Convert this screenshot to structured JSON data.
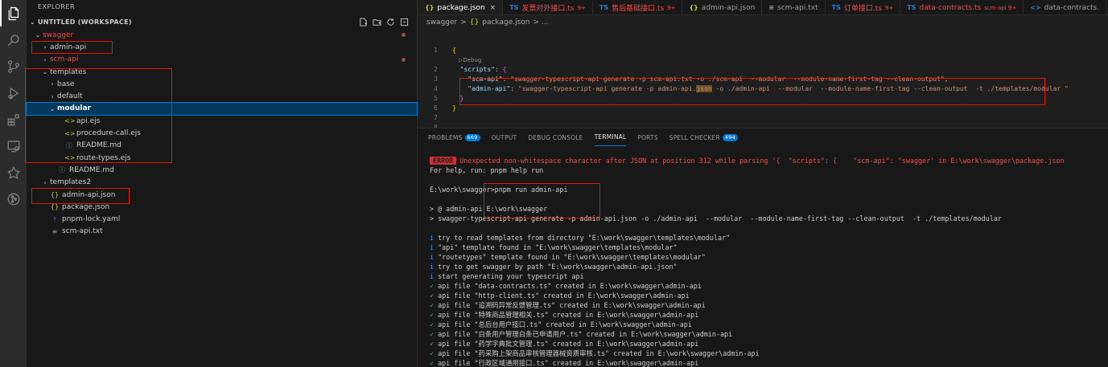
{
  "activity_bar": {
    "icons": [
      "files-icon",
      "search-icon",
      "source-control-icon",
      "run-debug-icon",
      "extensions-icon",
      "remote-explorer-icon",
      "gitlens-icon",
      "git-graph-icon"
    ]
  },
  "explorer": {
    "title": "EXPLORER",
    "workspace": "UNTITLED (WORKSPACE)",
    "tree": [
      {
        "label": "swagger",
        "depth": 0,
        "kind": "folder-open",
        "red": true,
        "dot": true
      },
      {
        "label": "admin-api",
        "depth": 1,
        "kind": "folder",
        "red": false,
        "dot": false
      },
      {
        "label": "scm-api",
        "depth": 1,
        "kind": "folder",
        "red": true,
        "dot": true
      },
      {
        "label": "templates",
        "depth": 1,
        "kind": "folder-open",
        "red": false,
        "dot": false
      },
      {
        "label": "base",
        "depth": 2,
        "kind": "folder",
        "red": false,
        "dot": false
      },
      {
        "label": "default",
        "depth": 2,
        "kind": "folder",
        "red": false,
        "dot": false
      },
      {
        "label": "modular",
        "depth": 2,
        "kind": "folder-open",
        "red": false,
        "dot": false,
        "selected": true
      },
      {
        "label": "api.ejs",
        "depth": 3,
        "kind": "ejs",
        "red": false,
        "dot": false
      },
      {
        "label": "procedure-call.ejs",
        "depth": 3,
        "kind": "ejs",
        "red": false,
        "dot": false
      },
      {
        "label": "README.md",
        "depth": 3,
        "kind": "info",
        "red": false,
        "dot": false
      },
      {
        "label": "route-types.ejs",
        "depth": 3,
        "kind": "ejs",
        "red": false,
        "dot": false
      },
      {
        "label": "README.md",
        "depth": 2,
        "kind": "info",
        "red": false,
        "dot": false
      },
      {
        "label": "templates2",
        "depth": 1,
        "kind": "folder",
        "red": false,
        "dot": false
      },
      {
        "label": "admin-api.json",
        "depth": 1,
        "kind": "json",
        "red": false,
        "dot": false
      },
      {
        "label": "package.json",
        "depth": 1,
        "kind": "json",
        "red": false,
        "dot": false
      },
      {
        "label": "pnpm-lock.yaml",
        "depth": 1,
        "kind": "yaml",
        "red": false,
        "dot": false
      },
      {
        "label": "scm-api.txt",
        "depth": 1,
        "kind": "txt",
        "red": false,
        "dot": false
      }
    ]
  },
  "tabs": [
    {
      "icon": "{}",
      "type": "json",
      "name": "package.json",
      "active": true,
      "err": false,
      "badge": "",
      "close": "×"
    },
    {
      "icon": "TS",
      "type": "ts",
      "name": "发票对外接口.ts",
      "active": false,
      "err": true,
      "badge": "9+",
      "close": ""
    },
    {
      "icon": "TS",
      "type": "ts",
      "name": "售后基础接口.ts",
      "active": false,
      "err": true,
      "badge": "9+",
      "close": ""
    },
    {
      "icon": "{}",
      "type": "json",
      "name": "admin-api.json",
      "active": false,
      "err": false,
      "badge": "",
      "close": ""
    },
    {
      "icon": "≡",
      "type": "txt",
      "name": "scm-api.txt",
      "active": false,
      "err": false,
      "badge": "",
      "close": ""
    },
    {
      "icon": "TS",
      "type": "ts",
      "name": "订单接口.ts",
      "active": false,
      "err": true,
      "badge": "9+",
      "close": ""
    },
    {
      "icon": "TS",
      "type": "ts",
      "name": "data-contracts.ts",
      "active": false,
      "err": true,
      "badge": "scm-api 9+",
      "close": ""
    },
    {
      "icon": "<>",
      "type": "ts",
      "name": "data-contracts.",
      "active": false,
      "err": false,
      "badge": "",
      "close": ""
    }
  ],
  "breadcrumb": {
    "folder": "swagger",
    "sep": ">",
    "file_icon": "{}",
    "file": "package.json",
    "tail": "> ..."
  },
  "code": {
    "debug_label": "▷Debug",
    "lines": [
      {
        "n": "1",
        "parts": [
          [
            "{",
            "c-brace"
          ]
        ]
      },
      {
        "n": "",
        "debug": true
      },
      {
        "n": "2",
        "parts": [
          [
            "  \"scripts\"",
            "c-key"
          ],
          [
            ": ",
            "c-punct"
          ],
          [
            "{",
            "c-brace2"
          ]
        ]
      },
      {
        "n": "3",
        "parts": [
          [
            "    \"scm-api\"",
            "c-key"
          ],
          [
            ": ",
            "c-punct"
          ],
          [
            "\"swagger-typescript-api generate -p scm-api.txt -o ./scm-api  --modular  --module-name-first-tag --clean-output\"",
            "c-str"
          ],
          [
            ",",
            "c-punct"
          ]
        ]
      },
      {
        "n": "4",
        "parts": [
          [
            "    \"admin-api\"",
            "c-key"
          ],
          [
            ": ",
            "c-punct"
          ],
          [
            "\"swagger-typescript-api generate -p admin-api.",
            "c-str"
          ],
          [
            "json",
            "c-str jsonhl"
          ],
          [
            " -o ./admin-api  --modular  --module-name-first-tag --clean-output  -t ./templates/modular \"",
            "c-str"
          ]
        ]
      },
      {
        "n": "5",
        "parts": [
          [
            "  }",
            "c-brace2"
          ]
        ]
      },
      {
        "n": "6",
        "parts": [
          [
            "}",
            "c-brace"
          ]
        ]
      },
      {
        "n": "7",
        "parts": []
      },
      {
        "n": "8",
        "parts": []
      }
    ]
  },
  "panel": {
    "tabs": [
      {
        "label": "PROBLEMS",
        "badge": "669",
        "active": false
      },
      {
        "label": "OUTPUT",
        "badge": "",
        "active": false
      },
      {
        "label": "DEBUG CONSOLE",
        "badge": "",
        "active": false
      },
      {
        "label": "TERMINAL",
        "badge": "",
        "active": true
      },
      {
        "label": "PORTS",
        "badge": "",
        "active": false
      },
      {
        "label": "SPELL CHECKER",
        "badge": "494",
        "active": false
      }
    ]
  },
  "terminal": {
    "error_badge": "ERROR",
    "error_text": "Unexpected non-whitespace character after JSON at position 312 while parsing '{  \"scripts\": {    \"scm-api\": \"swagger' in E:\\work\\swagger\\package.json",
    "help": "For help, run: pnpm help run",
    "prompt": "E:\\work\\swagger>pnpm run admin-api",
    "run1": "> @ admin-api E:\\work\\swagger",
    "run2": "> swagger-typescript-api generate -p admin-api.json -o ./admin-api  --modular  --module-name-first-tag --clean-output  -t ./templates/modular",
    "info_icon": "i",
    "check_icon": "✓",
    "info_lines": [
      "try to read templates from directory \"E:\\work\\swagger\\templates\\modular\"",
      "\"api\" template found in \"E:\\work\\swagger\\templates\\modular\"",
      "\"routetypes\" template found in \"E:\\work\\swagger\\templates\\modular\"",
      "try to get swagger by path \"E:\\work\\swagger\\admin-api.json\"",
      "start generating your typescript api"
    ],
    "created_lines": [
      "api file \"data-contracts.ts\" created in E:\\work\\swagger\\admin-api",
      "api file \"http-client.ts\" created in E:\\work\\swagger\\admin-api",
      "api file \"追溯码异常反馈管理.ts\" created in E:\\work\\swagger\\admin-api",
      "api file \"特殊商品管理相关.ts\" created in E:\\work\\swagger\\admin-api",
      "api file \"总后台用户接口.ts\" created in E:\\work\\swagger\\admin-api",
      "api file \"白条用户管理白条已申请用户.ts\" created in E:\\work\\swagger\\admin-api",
      "api file \"药学字典批文管理.ts\" created in E:\\work\\swagger\\admin-api",
      "api file \"药采购上架商品审核管理器械资质审核.ts\" created in E:\\work\\swagger\\admin-api",
      "api file \"行政区域通用接口.ts\" created in E:\\work\\swagger\\admin-api"
    ]
  }
}
